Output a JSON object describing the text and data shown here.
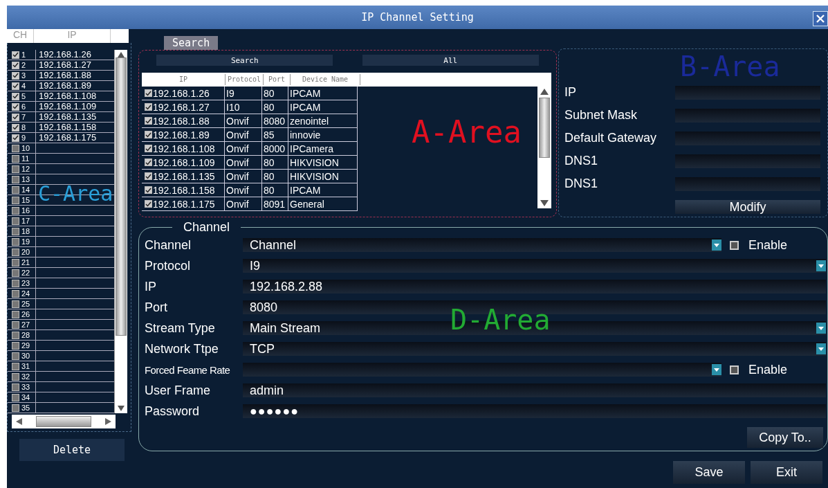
{
  "window": {
    "title": "IP Channel Setting"
  },
  "channel_list": {
    "columns": [
      "CH",
      "IP"
    ],
    "rows": [
      {
        "ch": "1",
        "ip": "192.168.1.26",
        "checked": true
      },
      {
        "ch": "2",
        "ip": "192.168.1.27",
        "checked": true
      },
      {
        "ch": "3",
        "ip": "192.168.1.88",
        "checked": true
      },
      {
        "ch": "4",
        "ip": "192.168.1.89",
        "checked": true
      },
      {
        "ch": "5",
        "ip": "192.168.1.108",
        "checked": true
      },
      {
        "ch": "6",
        "ip": "192.168.1.109",
        "checked": true
      },
      {
        "ch": "7",
        "ip": "192.168.1.135",
        "checked": true
      },
      {
        "ch": "8",
        "ip": "192.168.1.158",
        "checked": true
      },
      {
        "ch": "9",
        "ip": "192.168.1.175",
        "checked": true
      },
      {
        "ch": "10",
        "checked": false
      },
      {
        "ch": "11",
        "checked": false
      },
      {
        "ch": "12",
        "checked": false
      },
      {
        "ch": "13",
        "checked": false
      },
      {
        "ch": "14",
        "checked": false
      },
      {
        "ch": "15",
        "checked": false
      },
      {
        "ch": "16",
        "checked": false
      },
      {
        "ch": "17",
        "checked": false
      },
      {
        "ch": "18",
        "checked": false
      },
      {
        "ch": "19",
        "checked": false
      },
      {
        "ch": "20",
        "checked": false
      },
      {
        "ch": "21",
        "checked": false
      },
      {
        "ch": "22",
        "checked": false
      },
      {
        "ch": "23",
        "checked": false
      },
      {
        "ch": "24",
        "checked": false
      },
      {
        "ch": "25",
        "checked": false
      },
      {
        "ch": "26",
        "checked": false
      },
      {
        "ch": "27",
        "checked": false
      },
      {
        "ch": "28",
        "checked": false
      },
      {
        "ch": "29",
        "checked": false
      },
      {
        "ch": "30",
        "checked": false
      },
      {
        "ch": "31",
        "checked": false
      },
      {
        "ch": "32",
        "checked": false
      },
      {
        "ch": "33",
        "checked": false
      },
      {
        "ch": "34",
        "checked": false
      },
      {
        "ch": "35",
        "checked": false
      }
    ],
    "delete_button": "Delete"
  },
  "tabs": [
    {
      "label": "Search",
      "selected": true
    }
  ],
  "search_buttons": [
    "Search",
    "All"
  ],
  "device_table": {
    "columns": [
      "IP",
      "Protocol",
      "Port",
      "Device Name"
    ],
    "rows": [
      {
        "ip": "192.168.1.26",
        "protocol": "I9",
        "port": "80",
        "device_name": "IPCAM",
        "checked": true
      },
      {
        "ip": "192.168.1.27",
        "protocol": "I10",
        "port": "80",
        "device_name": "IPCAM",
        "checked": true
      },
      {
        "ip": "192.168.1.88",
        "protocol": "Onvif",
        "port": "8080",
        "device_name": "zenointel",
        "checked": true
      },
      {
        "ip": "192.168.1.89",
        "protocol": "Onvif",
        "port": "85",
        "device_name": "innovie",
        "checked": true
      },
      {
        "ip": "192.168.1.108",
        "protocol": "Onvif",
        "port": "8000",
        "device_name": "IPCamera",
        "checked": true
      },
      {
        "ip": "192.168.1.109",
        "protocol": "Onvif",
        "port": "80",
        "device_name": "HIKVISION",
        "checked": true
      },
      {
        "ip": "192.168.1.135",
        "protocol": "Onvif",
        "port": "80",
        "device_name": "HIKVISION",
        "checked": true
      },
      {
        "ip": "192.168.1.158",
        "protocol": "Onvif",
        "port": "80",
        "device_name": "IPCAM",
        "checked": true
      },
      {
        "ip": "192.168.1.175",
        "protocol": "Onvif",
        "port": "8091",
        "device_name": "General",
        "checked": true
      }
    ]
  },
  "network": {
    "fields": [
      {
        "label": "IP"
      },
      {
        "label": "Subnet Mask"
      },
      {
        "label": "Default Gateway"
      },
      {
        "label": "DNS1"
      },
      {
        "label": "DNS1"
      }
    ],
    "modify_button": "Modify"
  },
  "channel_settings": {
    "legend": "Channel",
    "fields": [
      {
        "label": "Channel",
        "kind": "select",
        "value": "Channel",
        "enable": {
          "label": "Enable",
          "checked": false
        }
      },
      {
        "label": "Protocol",
        "kind": "select",
        "value": "I9"
      },
      {
        "label": "IP",
        "kind": "text",
        "value": "192.168.2.88"
      },
      {
        "label": "Port",
        "kind": "text",
        "value": "8080"
      },
      {
        "label": "Stream Type",
        "kind": "select",
        "value": "Main Stream"
      },
      {
        "label": "Network Ttpe",
        "kind": "select",
        "value": "TCP"
      },
      {
        "label": "Forced Feame Rate",
        "kind": "select",
        "enable": {
          "label": "Enable",
          "checked": false
        }
      },
      {
        "label": "User Frame",
        "kind": "text",
        "value": "admin"
      },
      {
        "label": "Password",
        "kind": "password",
        "value": "●●●●●●"
      }
    ],
    "copy_button": "Copy To.."
  },
  "footer_buttons": [
    "Save",
    "Exit"
  ],
  "area_labels": [
    {
      "text": "C-Area",
      "color": "#2a9fd8"
    },
    {
      "text": "A-Area",
      "color": "#e01020"
    },
    {
      "text": "B-Area",
      "color": "#1a2a9a"
    },
    {
      "text": "D-Area",
      "color": "#22aa33"
    }
  ]
}
